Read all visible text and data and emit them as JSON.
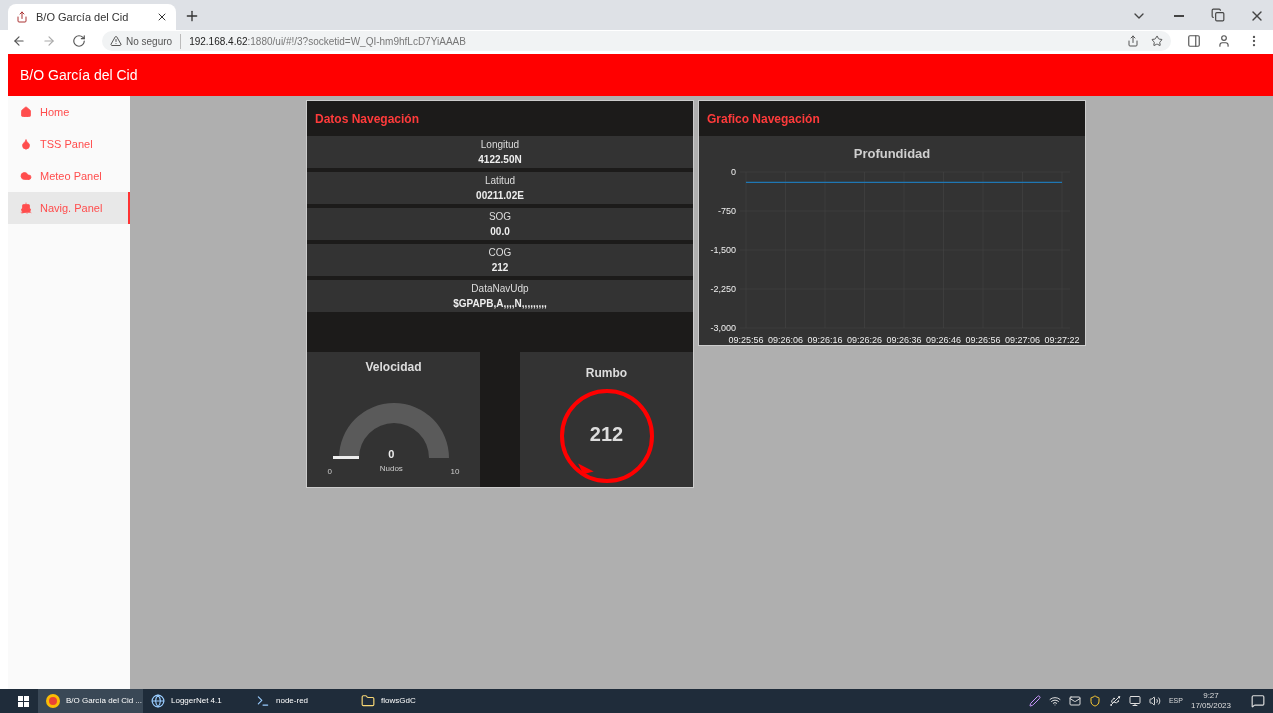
{
  "browser": {
    "tab_title": "B/O García del Cid",
    "url_warning": "No seguro",
    "url_host": "192.168.4.62",
    "url_rest": ":1880/ui/#!/3?socketid=W_QI-hm9hfLcD7YiAAAB"
  },
  "header": {
    "title": "B/O García del Cid"
  },
  "sidebar": {
    "items": [
      {
        "label": "Home",
        "selected": false
      },
      {
        "label": "TSS Panel",
        "selected": false
      },
      {
        "label": "Meteo Panel",
        "selected": false
      },
      {
        "label": "Navig. Panel",
        "selected": true
      }
    ]
  },
  "datos": {
    "title": "Datos Navegación",
    "fields": [
      {
        "label": "Longitud",
        "value": "4122.50N"
      },
      {
        "label": "Latitud",
        "value": "00211.02E"
      },
      {
        "label": "SOG",
        "value": "00.0"
      },
      {
        "label": "COG",
        "value": "212"
      },
      {
        "label": "DataNavUdp",
        "value": "$GPAPB,A,,,,N,,,,,,,,,"
      }
    ],
    "speed_gauge": {
      "title": "Velocidad",
      "value": "0",
      "unit": "Nudos",
      "min": "0",
      "max": "10"
    },
    "heading": {
      "title": "Rumbo",
      "value": "212"
    }
  },
  "grafico": {
    "title": "Grafico Navegación",
    "chart_data": {
      "type": "line",
      "title": "Profundidad",
      "categories": [
        "09:25:56",
        "09:26:06",
        "09:26:16",
        "09:26:26",
        "09:26:36",
        "09:26:46",
        "09:26:56",
        "09:27:06",
        "09:27:22"
      ],
      "series": [
        {
          "color": "#1f77b4",
          "values": [
            -200,
            -200,
            -200,
            -200,
            -200,
            -200,
            -200,
            -200,
            -200
          ]
        }
      ],
      "ylim": [
        -3000,
        0
      ],
      "grid": true,
      "yticks": [
        {
          "value": 0,
          "label": "0"
        },
        {
          "value": -750,
          "label": "-750"
        },
        {
          "value": -1500,
          "label": "-1,500"
        },
        {
          "value": -2250,
          "label": "-2,250"
        },
        {
          "value": -3000,
          "label": "-3,000"
        }
      ]
    }
  },
  "taskbar": {
    "items": [
      {
        "label": "B/O García del Cid ...",
        "selected": true
      },
      {
        "label": "LoggerNet 4.1",
        "selected": false
      },
      {
        "label": "node-red",
        "selected": false
      },
      {
        "label": "flowsGdC",
        "selected": false
      }
    ],
    "language": "ESP",
    "time": "9:27",
    "date": "17/05/2023"
  }
}
